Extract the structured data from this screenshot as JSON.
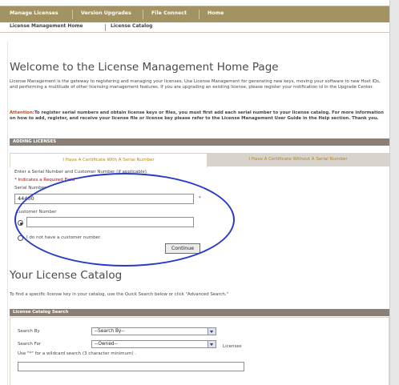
{
  "topnav": {
    "items": [
      "Manage Licenses",
      "Version Upgrades",
      "File Connect",
      "Home"
    ]
  },
  "subnav": {
    "items": [
      "License Management Home",
      "License Catalog"
    ]
  },
  "page": {
    "title": "Welcome to the License Management Home Page",
    "intro": "License Management is the gateway to registering and managing your licenses. Use License Management for generating new keys, moving your software to new Host IDs, and performing a multitude of other licensing management features. If you are upgrading an existing license, please register your notification id in the Upgrade Center.",
    "attention_label": "Attention:",
    "attention_text": "To register serial numbers and obtain license keys or files, you must first add each serial number to your license catalog. For more information on how to add, register, and receive your license file or license key please refer to the License Management User Guide in the Help section. Thank you."
  },
  "adding": {
    "header": "ADDING LICENSES",
    "tab_with_serial": "I Have A Certificate With A Serial Number",
    "tab_without_serial": "I Have A Certificate Without A Serial Number",
    "instructions": "Enter a Serial Number and Customer Number (if applicable).",
    "required_note": "* Indicates a Required Field",
    "serial_label": "Serial Number",
    "serial_value": "44400",
    "customer_label": "Customer Number",
    "customer_value": "",
    "no_customer_label": "I do not have a customer number.",
    "continue_label": "Continue"
  },
  "catalog": {
    "title": "Your License Catalog",
    "description": "To find a specific license key in your catalog, use the Quick Search below or click \"Advanced Search.\"",
    "search_header": "License Catalog Search",
    "search_by_label": "Search By",
    "search_by_value": "--Search By--",
    "search_for_label": "Search For",
    "search_for_value": "--Owned--",
    "licenses_label": "Licenses",
    "wildcard_hint": "Use \"*\" for a wildcard search (3 character minimum) .",
    "search_text_value": ""
  },
  "colors": {
    "nav": "#a39262",
    "section_bar": "#8a7f76",
    "annotation_oval": "#2b39c9",
    "attention": "#cc4400"
  }
}
